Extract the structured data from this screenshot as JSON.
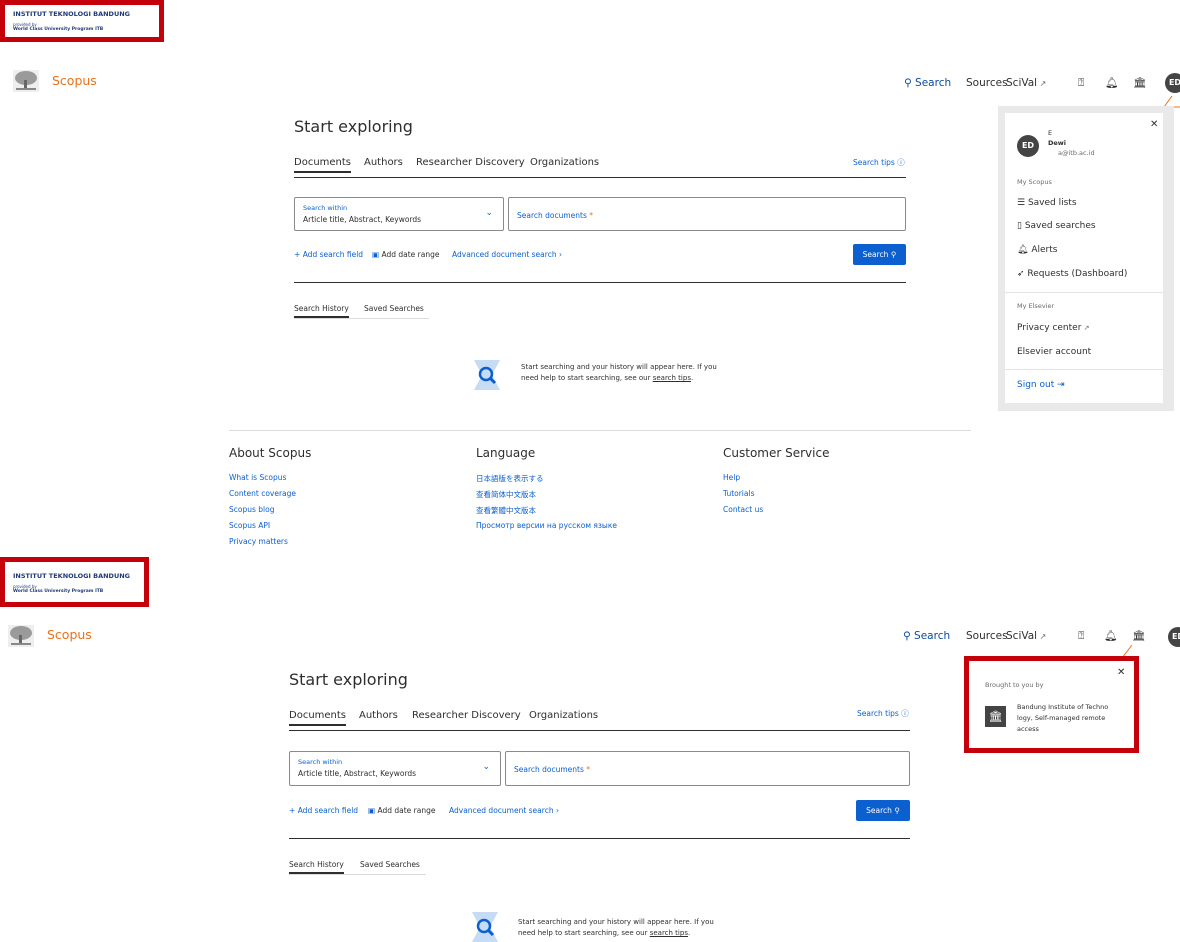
{
  "institution_banner": {
    "name": "INSTITUT TEKNOLOGI BANDUNG",
    "provided_by": "provided by",
    "program": "World Class University Program ITB"
  },
  "brand": "Scopus",
  "nav": {
    "search": "Search",
    "sources": "Sources",
    "scival": "SciVal",
    "avatar_initials": "ED"
  },
  "main": {
    "title": "Start exploring",
    "tabs": [
      "Documents",
      "Authors",
      "Researcher Discovery",
      "Organizations"
    ],
    "search_tips": "Search tips",
    "search_within_label": "Search within",
    "search_within_value": "Article title, Abstract, Keywords",
    "search_placeholder": "Search documents",
    "required_mark": "*",
    "add_search_field": "Add search field",
    "add_date_range": "Add date range",
    "advanced_search": "Advanced document search",
    "search_button": "Search",
    "history_tabs": [
      "Search History",
      "Saved Searches"
    ],
    "empty_text_1": "Start searching and your history will appear here. If you",
    "empty_text_2": "need help to start searching, see our",
    "empty_link": "search tips",
    "empty_end": "."
  },
  "footer": {
    "about": {
      "heading": "About Scopus",
      "links": [
        "What is Scopus",
        "Content coverage",
        "Scopus blog",
        "Scopus API",
        "Privacy matters"
      ]
    },
    "language": {
      "heading": "Language",
      "links": [
        "日本語版を表示する",
        "查看简体中文版本",
        "查看繁體中文版本",
        "Просмотр версии на русском языке"
      ]
    },
    "service": {
      "heading": "Customer Service",
      "links": [
        "Help",
        "Tutorials",
        "Contact us"
      ]
    }
  },
  "user_menu": {
    "initials": "ED",
    "first": "E",
    "last": "Dewi",
    "email": "a@itb.ac.id",
    "my_scopus": "My Scopus",
    "saved_lists": "Saved lists",
    "saved_searches": "Saved searches",
    "alerts": "Alerts",
    "requests": "Requests (Dashboard)",
    "my_elsevier": "My Elsevier",
    "privacy_center": "Privacy center",
    "elsevier_account": "Elsevier account",
    "sign_out": "Sign out"
  },
  "institution_popup": {
    "header": "Brought to you by",
    "line1": "Bandung Institute of Techno",
    "line2": "logy, Self-managed remote",
    "line3": "access"
  },
  "colors": {
    "brand_orange": "#e9711c",
    "link_blue": "#0c5fce",
    "highlight_red": "#c4000a"
  }
}
